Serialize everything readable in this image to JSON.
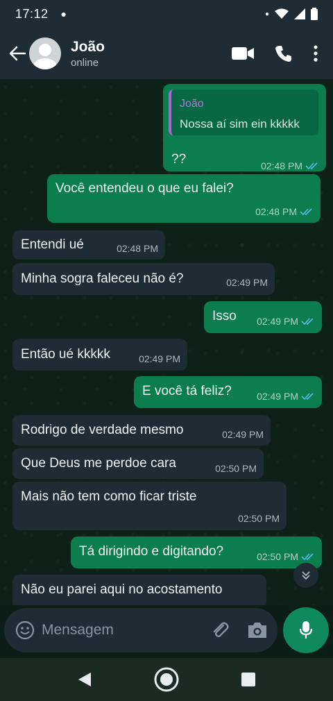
{
  "statusbar": {
    "time": "17:12"
  },
  "header": {
    "name": "João",
    "status": "online"
  },
  "quote": {
    "author": "João",
    "text": "Nossa aí sim ein kkkkk"
  },
  "messages": [
    {
      "dir": "out",
      "text": "??",
      "time": "02:48 PM",
      "read": true
    },
    {
      "dir": "out",
      "text": "Você entendeu o que eu falei?",
      "time": "02:48 PM",
      "read": true
    },
    {
      "dir": "in",
      "text": "Entendi ué",
      "time": "02:48 PM"
    },
    {
      "dir": "in",
      "text": "Minha sogra faleceu não é?",
      "time": "02:49 PM"
    },
    {
      "dir": "out",
      "text": "Isso",
      "time": "02:49 PM",
      "read": true
    },
    {
      "dir": "in",
      "text": "Então ué kkkkk",
      "time": "02:49 PM"
    },
    {
      "dir": "out",
      "text": "E você tá feliz?",
      "time": "02:49 PM",
      "read": true
    },
    {
      "dir": "in",
      "text": "Rodrigo de verdade mesmo",
      "time": "02:49 PM"
    },
    {
      "dir": "in",
      "text": "Que Deus me perdoe cara",
      "time": "02:50 PM"
    },
    {
      "dir": "in",
      "text": "Mais não tem como ficar triste",
      "time": "02:50 PM"
    },
    {
      "dir": "out",
      "text": "Tá dirigindo e digitando?",
      "time": "02:50 PM",
      "read": true
    },
    {
      "dir": "in",
      "text": "Não eu parei aqui no acostamento",
      "time": ""
    }
  ],
  "composer": {
    "placeholder": "Mensagem"
  },
  "colors": {
    "outgoing": "#0b7d4f",
    "incoming": "#1f2c34",
    "tick": "#53bdeb",
    "accent": "#0f8a5f"
  },
  "icons": [
    "back-arrow-icon",
    "video-call-icon",
    "phone-icon",
    "more-vert-icon",
    "emoji-icon",
    "attach-icon",
    "camera-icon",
    "mic-icon",
    "double-check-icon",
    "chevron-down-icon"
  ]
}
